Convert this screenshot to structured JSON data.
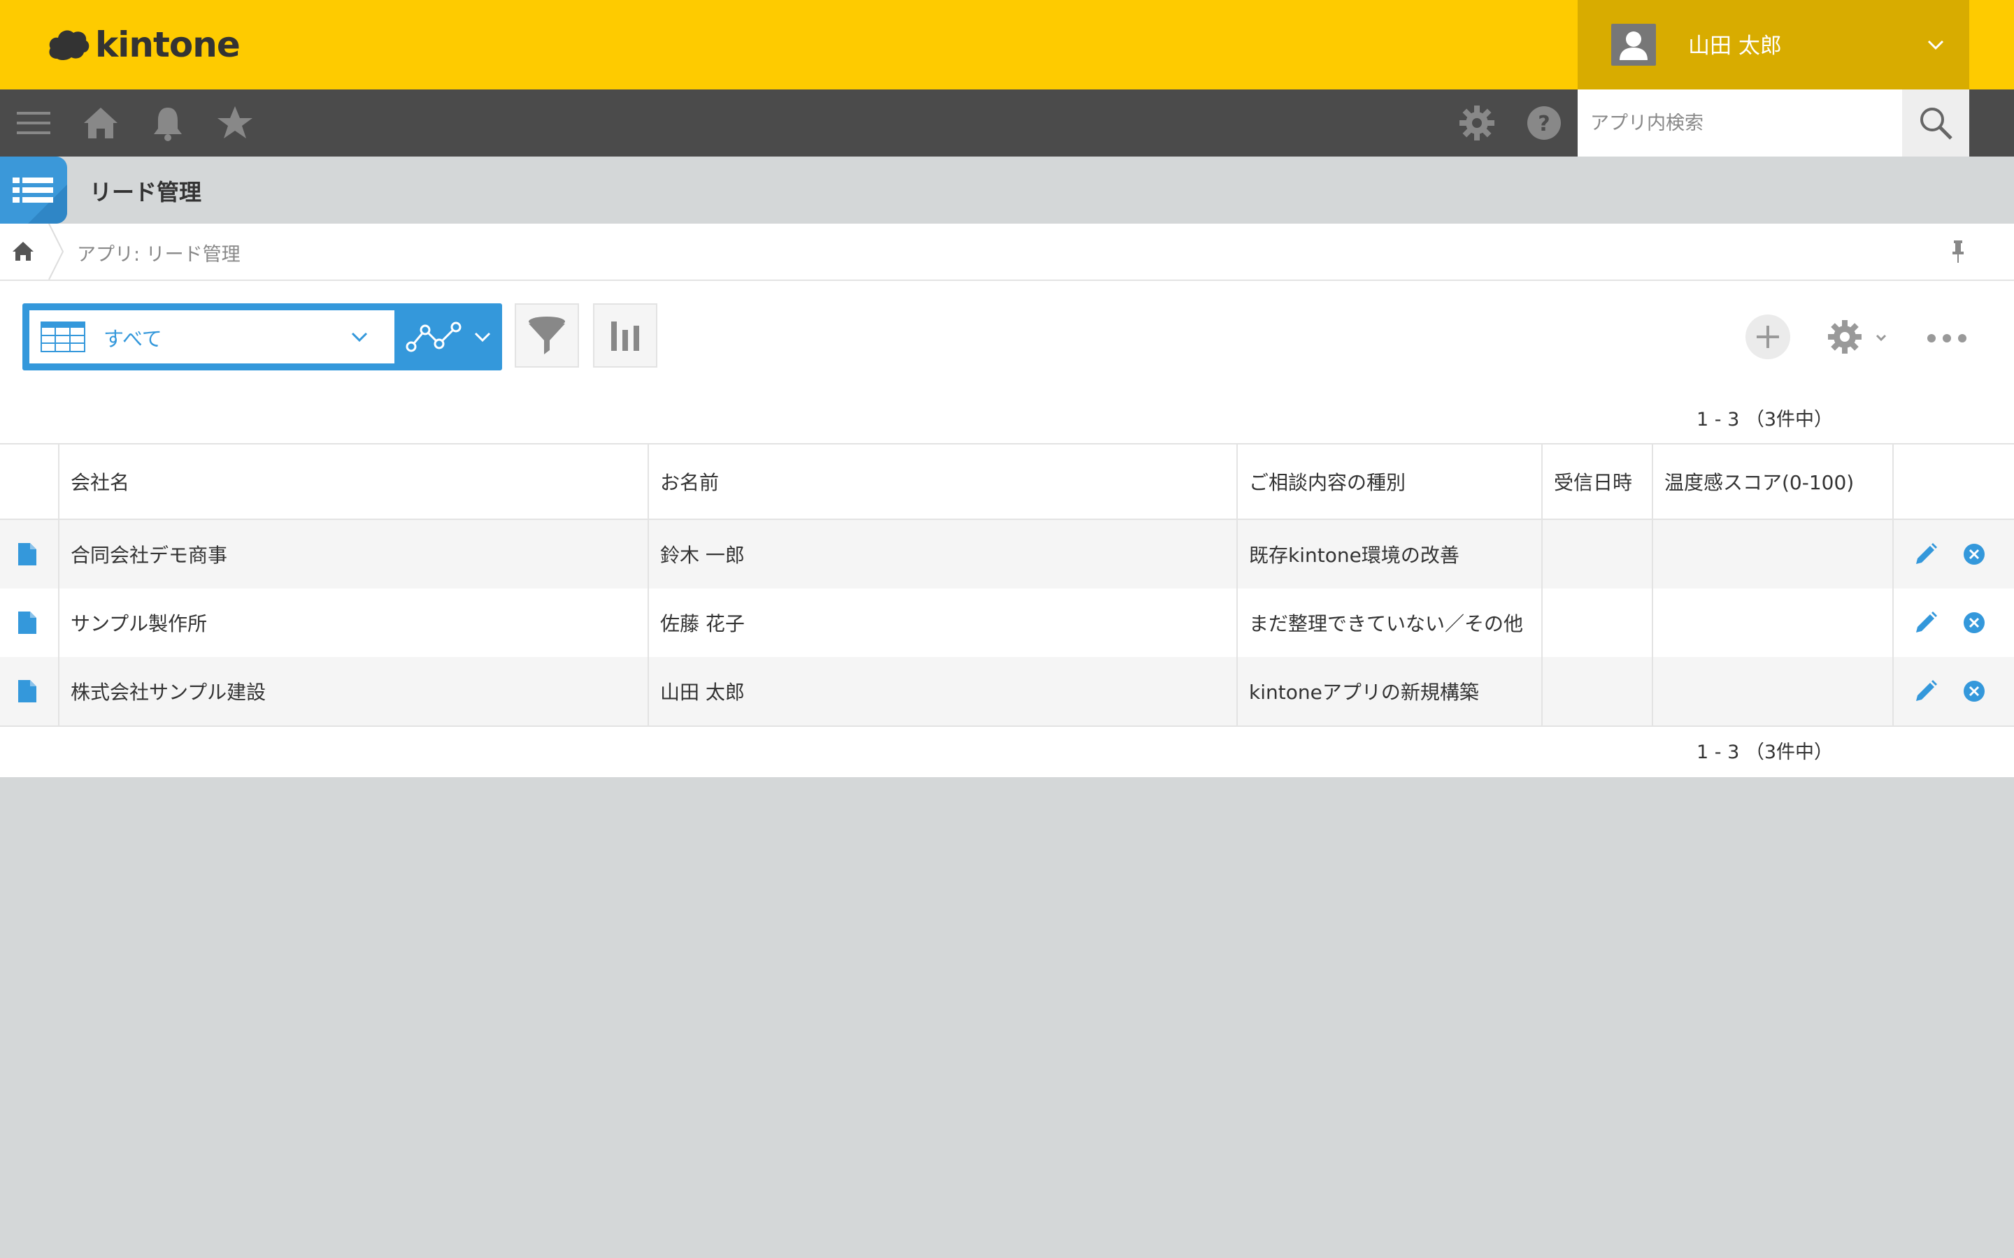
{
  "header": {
    "logo_text": "kintone",
    "user_name": "山田 太郎",
    "brand_color": "#fecb00"
  },
  "global_nav": {
    "icons": [
      "menu-icon",
      "home-icon",
      "bell-icon",
      "star-icon",
      "gear-icon",
      "help-icon"
    ],
    "search_placeholder": "アプリ内検索"
  },
  "app": {
    "title": "リード管理"
  },
  "breadcrumb": {
    "text": "アプリ: リード管理"
  },
  "toolbar": {
    "view_label": "すべて",
    "accent_color": "#3498db"
  },
  "pager": {
    "top": "1 - 3 （3件中）",
    "bottom": "1 - 3 （3件中）"
  },
  "table": {
    "columns": [
      "会社名",
      "お名前",
      "ご相談内容の種別",
      "受信日時",
      "温度感スコア(0-100)"
    ],
    "rows": [
      [
        "合同会社デモ商事",
        "鈴木 一郎",
        "既存kintone環境の改善",
        "",
        ""
      ],
      [
        "サンプル製作所",
        "佐藤 花子",
        "まだ整理できていない／その他",
        "",
        ""
      ],
      [
        "株式会社サンプル建設",
        "山田 太郎",
        "kintoneアプリの新規構築",
        "",
        ""
      ]
    ]
  }
}
